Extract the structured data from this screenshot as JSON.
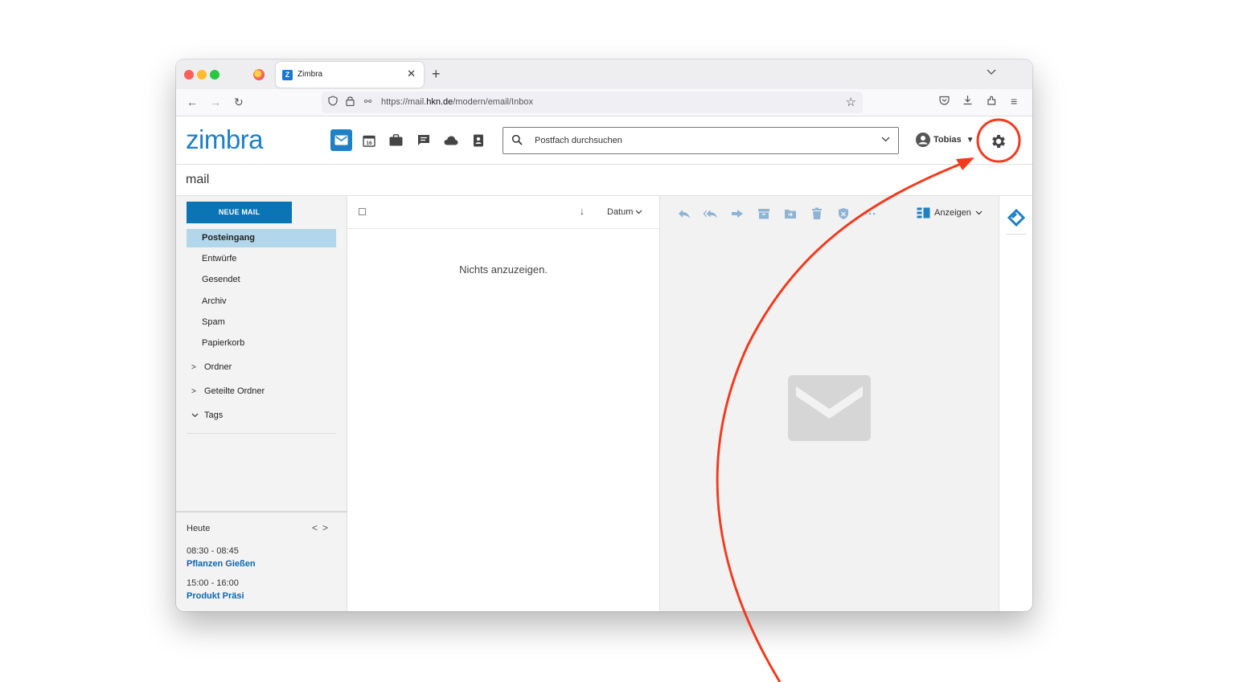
{
  "browser": {
    "tab_title": "Zimbra",
    "tab_favicon": "Z",
    "url_prefix": "https://mail.",
    "url_domain": "hkn.de",
    "url_path": "/modern/email/Inbox"
  },
  "app": {
    "logo": "zimbra",
    "search_placeholder": "Postfach durchsuchen",
    "user_name": "Tobias",
    "section_title": "mail",
    "accent_color": "#1f80c5"
  },
  "sidebar": {
    "new_mail_label": "NEUE MAIL",
    "folders": [
      "Posteingang",
      "Entwürfe",
      "Gesendet",
      "Archiv",
      "Spam",
      "Papierkorb"
    ],
    "active_folder": "Posteingang",
    "groups": [
      "Ordner",
      "Geteilte Ordner",
      "Tags"
    ],
    "calendar": {
      "heading": "Heute",
      "events": [
        {
          "time": "08:30 - 08:45",
          "title": "Pflanzen Gießen"
        },
        {
          "time": "15:00 - 16:00",
          "title": "Produkt Präsi"
        }
      ]
    }
  },
  "list": {
    "sort_label": "Datum",
    "empty_text": "Nichts anzuzeigen."
  },
  "reader": {
    "view_label": "Anzeigen"
  },
  "annotation": {
    "color": "#f23a1e",
    "target": "gear-icon"
  }
}
